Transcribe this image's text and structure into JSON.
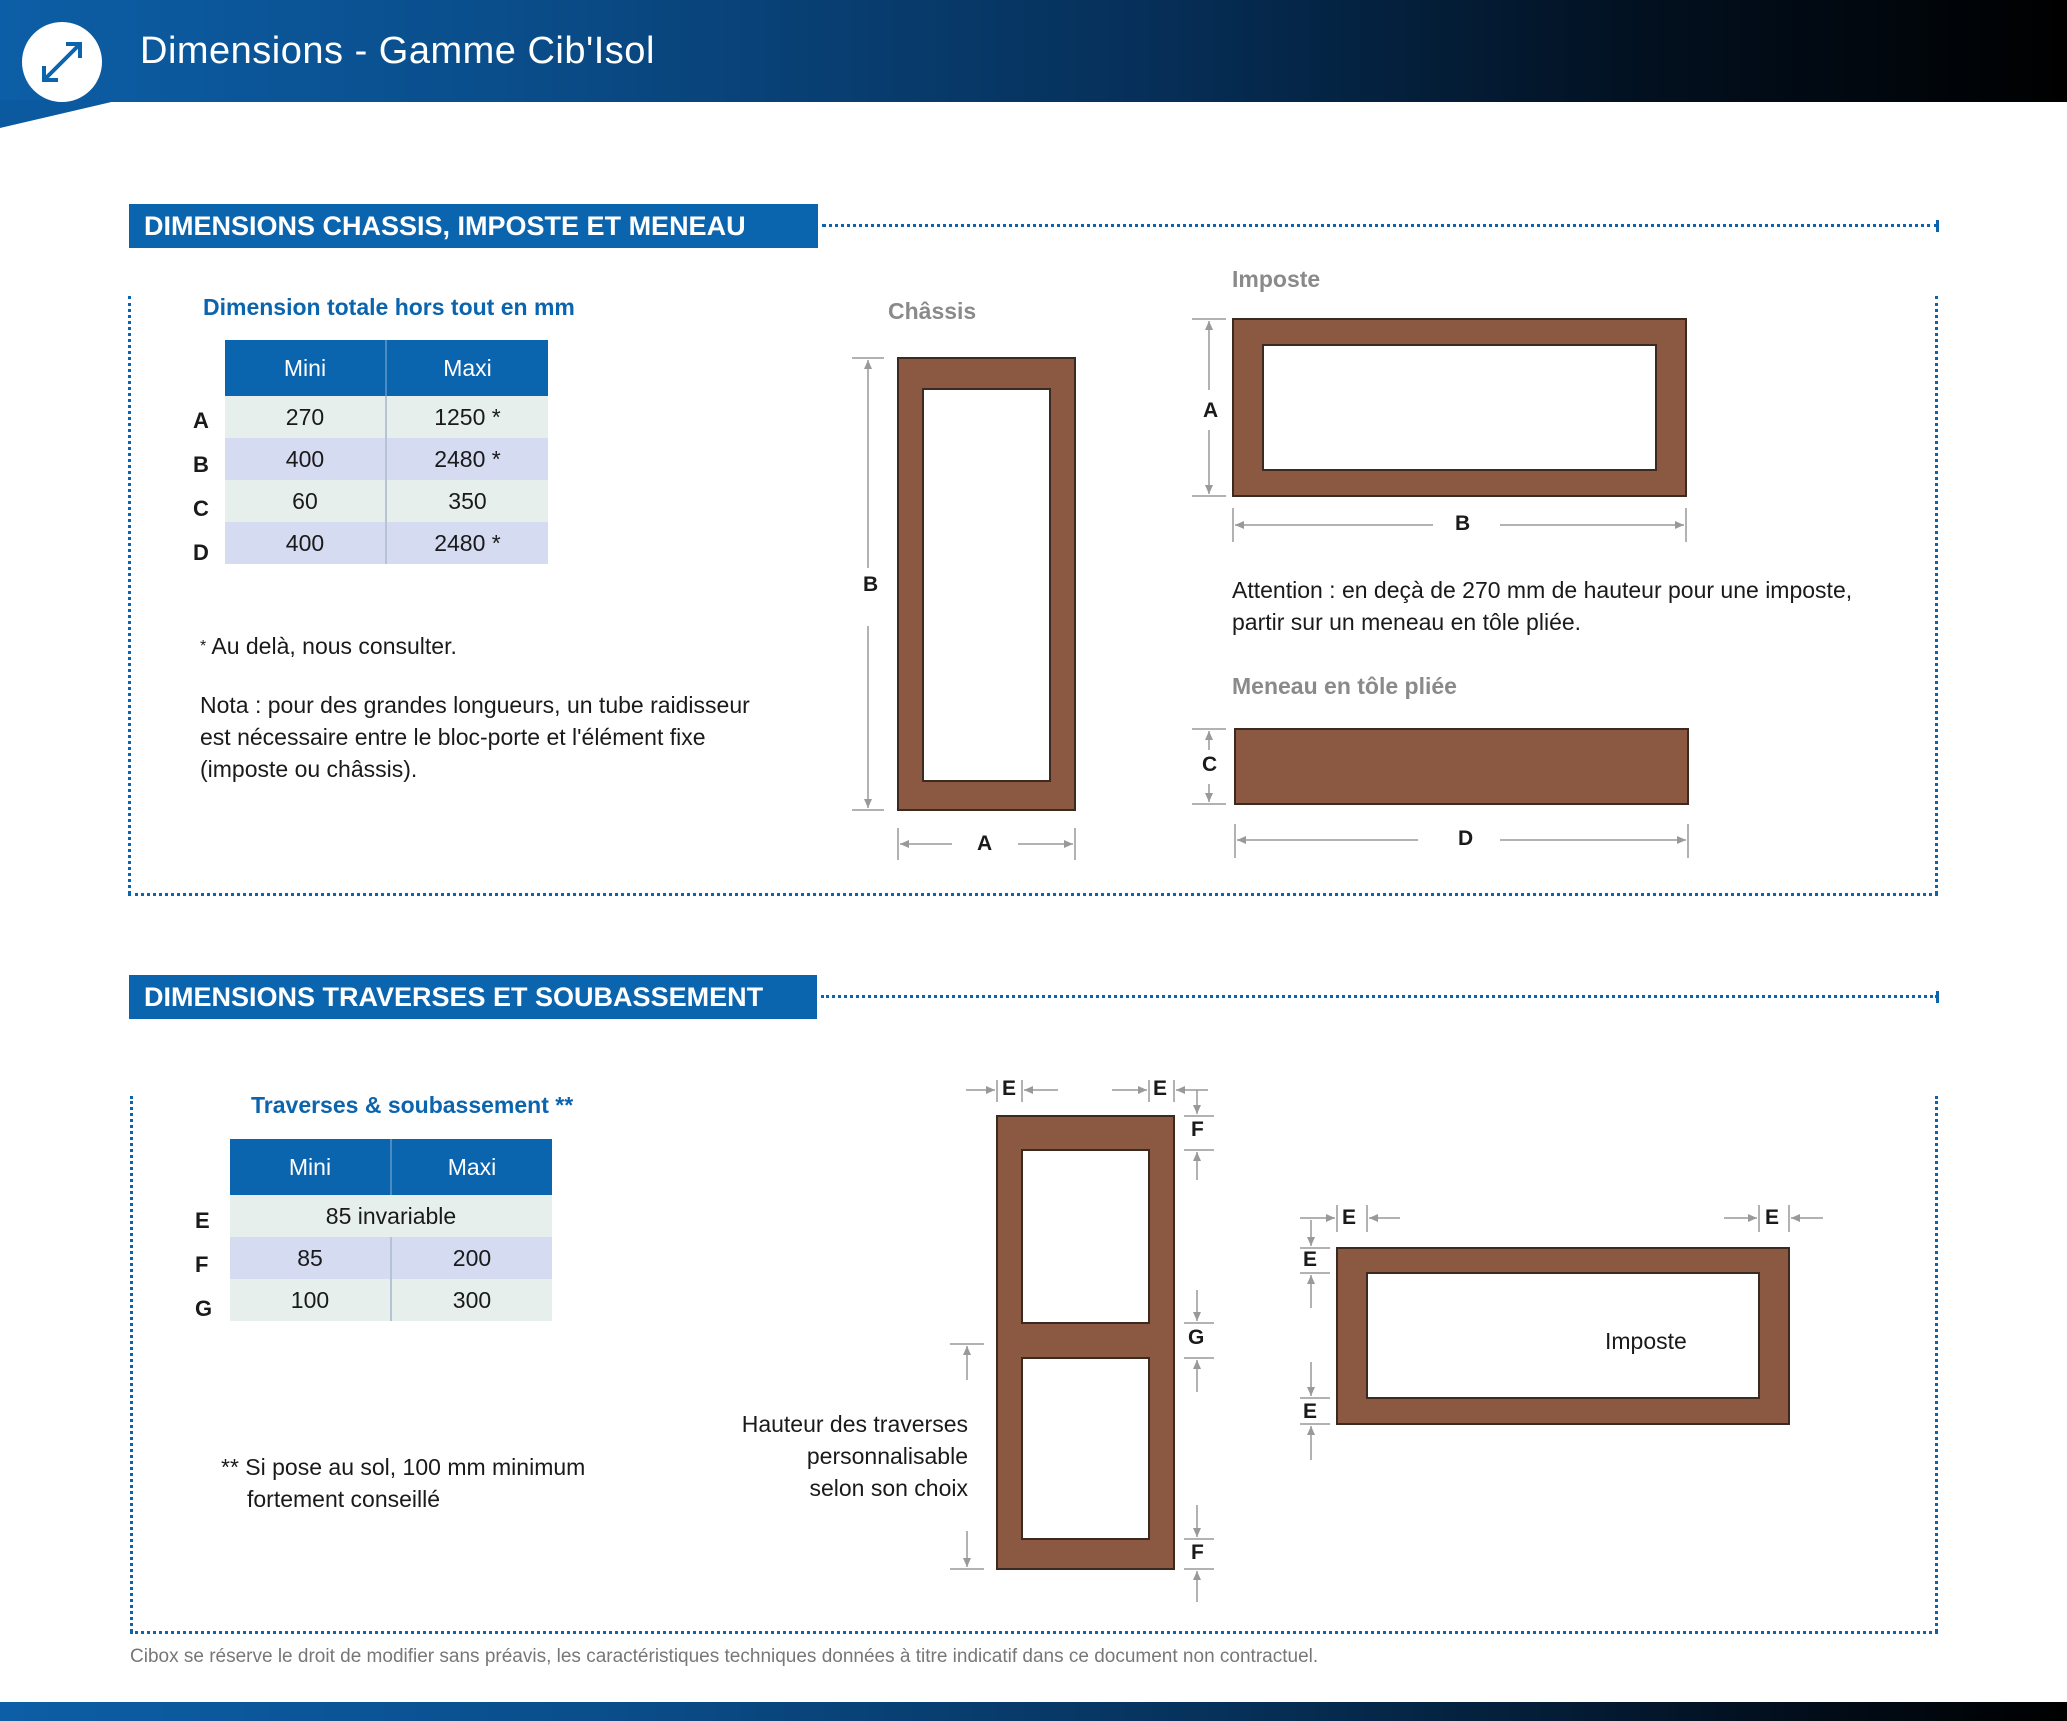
{
  "header": {
    "title": "Dimensions - Gamme Cib'Isol",
    "icon": "resize-arrows-icon"
  },
  "section1": {
    "title": "DIMENSIONS CHASSIS, IMPOSTE ET MENEAU",
    "table_caption": "Dimension totale hors tout en mm",
    "columns": [
      "Mini",
      "Maxi"
    ],
    "rows": [
      {
        "label": "A",
        "mini": "270",
        "maxi": "1250 *"
      },
      {
        "label": "B",
        "mini": "400",
        "maxi": "2480 *"
      },
      {
        "label": "C",
        "mini": "60",
        "maxi": "350"
      },
      {
        "label": "D",
        "mini": "400",
        "maxi": "2480 *"
      }
    ],
    "footnote_mark": "*",
    "footnote": "Au delà, nous consulter.",
    "nota": [
      "Nota : pour des grandes longueurs, un tube raidisseur",
      "est nécessaire entre le bloc-porte et l'élément fixe",
      "(imposte ou châssis)."
    ],
    "chassis_title": "Châssis",
    "imposte_title": "Imposte",
    "meneau_title": "Meneau en tôle pliée",
    "attention": [
      "Attention : en deçà de 270 mm de hauteur pour une imposte,",
      "partir sur un meneau en tôle pliée."
    ],
    "labels": {
      "a": "A",
      "b": "B",
      "c": "C",
      "d": "D"
    }
  },
  "section2": {
    "title": "DIMENSIONS TRAVERSES ET SOUBASSEMENT",
    "table_caption": "Traverses & soubassement **",
    "columns": [
      "Mini",
      "Maxi"
    ],
    "rows": [
      {
        "label": "E",
        "merged": "85 invariable"
      },
      {
        "label": "F",
        "mini": "85",
        "maxi": "200"
      },
      {
        "label": "G",
        "mini": "100",
        "maxi": "300"
      }
    ],
    "footnote": [
      "** Si pose au sol, 100 mm minimum",
      "fortement conseillé"
    ],
    "hauteur_note": [
      "Hauteur des traverses",
      "personnalisable",
      "selon son choix"
    ],
    "imposte_label": "Imposte",
    "labels": {
      "e": "E",
      "f": "F",
      "g": "G"
    }
  },
  "colors": {
    "brand_blue": "#0b64ae",
    "frame_brown": "#8b5842",
    "dim_gray": "#999999"
  },
  "footer": {
    "disclaimer": "Cibox se réserve le droit de modifier sans préavis, les caractéristiques techniques données à titre indicatif dans ce document non contractuel."
  }
}
